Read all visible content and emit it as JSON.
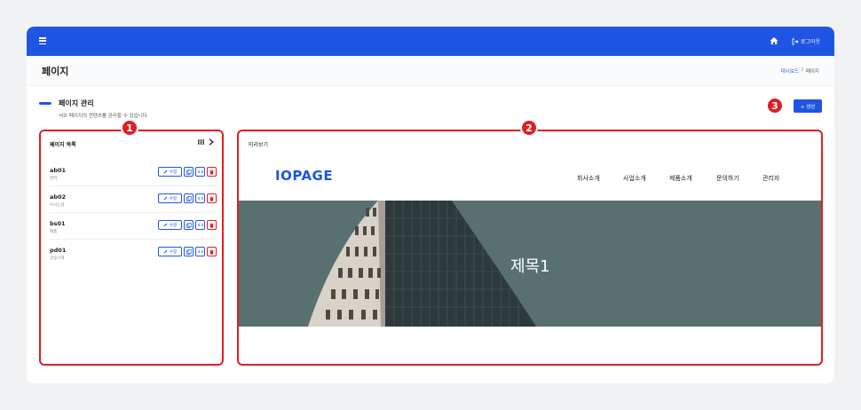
{
  "topbar": {
    "logout_label": "로그아웃"
  },
  "header": {
    "title": "페이지",
    "breadcrumb": [
      "대시보드",
      "/",
      "페이지"
    ]
  },
  "section": {
    "title": "페이지 관리",
    "description": "서브 페이지의 컨텐츠를 관리할 수 있습니다.",
    "create_label": "+ 생성"
  },
  "badges": [
    "1",
    "2",
    "3"
  ],
  "page_list": {
    "title": "페이지 목록",
    "edit_label": "수정",
    "items": [
      {
        "id": "ab01",
        "name": "연혁"
      },
      {
        "id": "ab02",
        "name": "오시는길"
      },
      {
        "id": "bs01",
        "name": "제품"
      },
      {
        "id": "pd01",
        "name": "양웅기계"
      }
    ]
  },
  "preview": {
    "label": "미리보기",
    "logo_text": "IOPAGE",
    "nav": [
      "회사소개",
      "사업소개",
      "제품소개",
      "문의하기",
      "관리자"
    ],
    "hero_title": "제목1"
  },
  "colors": {
    "primary": "#1f55e3",
    "highlight": "#e01e24",
    "hero_bg": "#597071"
  }
}
